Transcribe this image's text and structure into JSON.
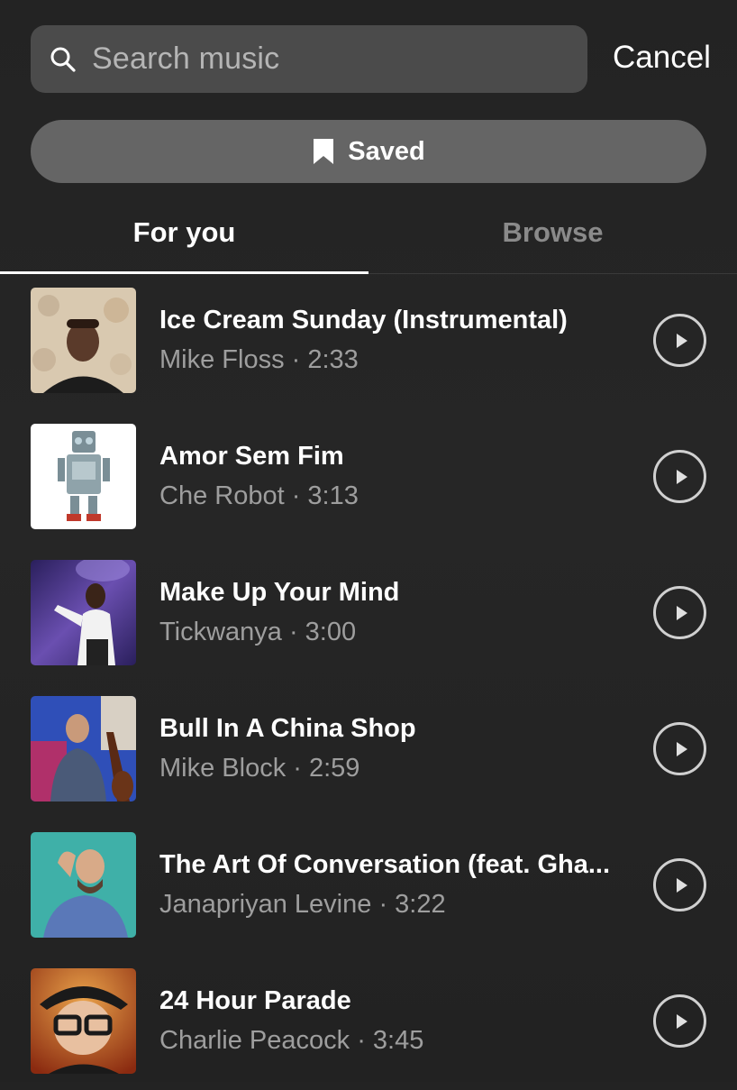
{
  "search": {
    "placeholder": "Search music",
    "cancel_label": "Cancel"
  },
  "saved": {
    "label": "Saved",
    "icon": "bookmark-icon"
  },
  "tabs": [
    {
      "label": "For you",
      "active": true
    },
    {
      "label": "Browse",
      "active": false
    }
  ],
  "tracks": [
    {
      "title": "Ice Cream Sunday (Instrumental)",
      "artist": "Mike Floss",
      "duration": "2:33",
      "meta": "Mike Floss · 2:33"
    },
    {
      "title": "Amor Sem Fim",
      "artist": "Che Robot",
      "duration": "3:13",
      "meta": "Che Robot · 3:13"
    },
    {
      "title": "Make Up Your Mind",
      "artist": "Tickwanya",
      "duration": "3:00",
      "meta": "Tickwanya · 3:00"
    },
    {
      "title": "Bull In A China Shop",
      "artist": "Mike Block",
      "duration": "2:59",
      "meta": "Mike Block · 2:59"
    },
    {
      "title": "The Art Of Conversation (feat. Gha...",
      "artist": "Janapriyan Levine",
      "duration": "3:22",
      "meta": "Janapriyan Levine · 3:22"
    },
    {
      "title": "24 Hour Parade",
      "artist": "Charlie Peacock",
      "duration": "3:45",
      "meta": "Charlie Peacock · 3:45"
    }
  ],
  "colors": {
    "background": "#232323",
    "search_bg": "#4b4b4b",
    "saved_bg": "#656565",
    "active_tab": "#ffffff",
    "inactive_tab": "#8a8a8a",
    "secondary_text": "#9e9e9e"
  }
}
